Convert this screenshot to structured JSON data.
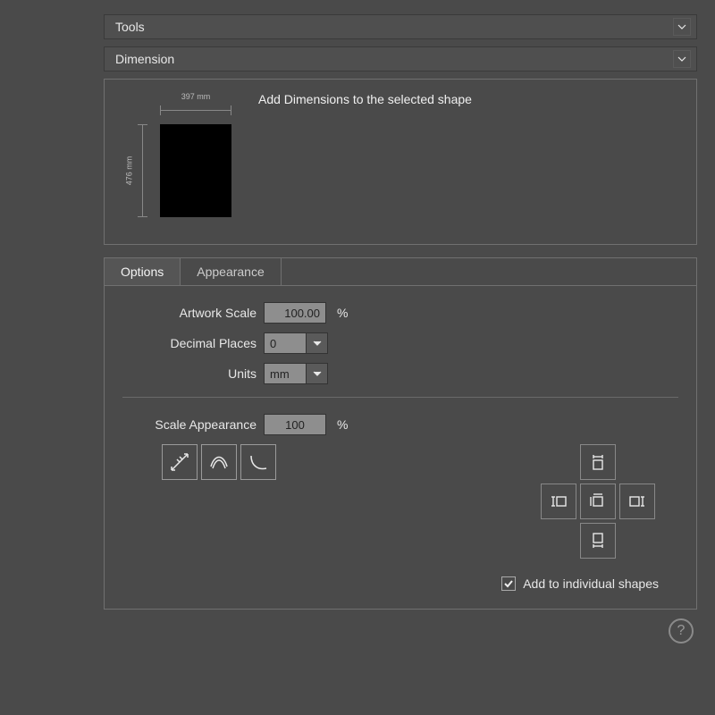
{
  "sections": {
    "tools": {
      "title": "Tools"
    },
    "dimension": {
      "title": "Dimension"
    }
  },
  "preview": {
    "width_label": "397 mm",
    "height_label": "476 mm",
    "description": "Add Dimensions to the selected shape"
  },
  "tabs": {
    "options": "Options",
    "appearance": "Appearance"
  },
  "options": {
    "artwork_scale_label": "Artwork Scale",
    "artwork_scale_value": "100.00",
    "artwork_scale_unit": "%",
    "decimal_places_label": "Decimal Places",
    "decimal_places_value": "0",
    "units_label": "Units",
    "units_value": "mm",
    "scale_appearance_label": "Scale Appearance",
    "scale_appearance_value": "100",
    "scale_appearance_unit": "%",
    "add_individual_label": "Add to individual shapes",
    "add_individual_checked": true
  },
  "help_label": "?"
}
